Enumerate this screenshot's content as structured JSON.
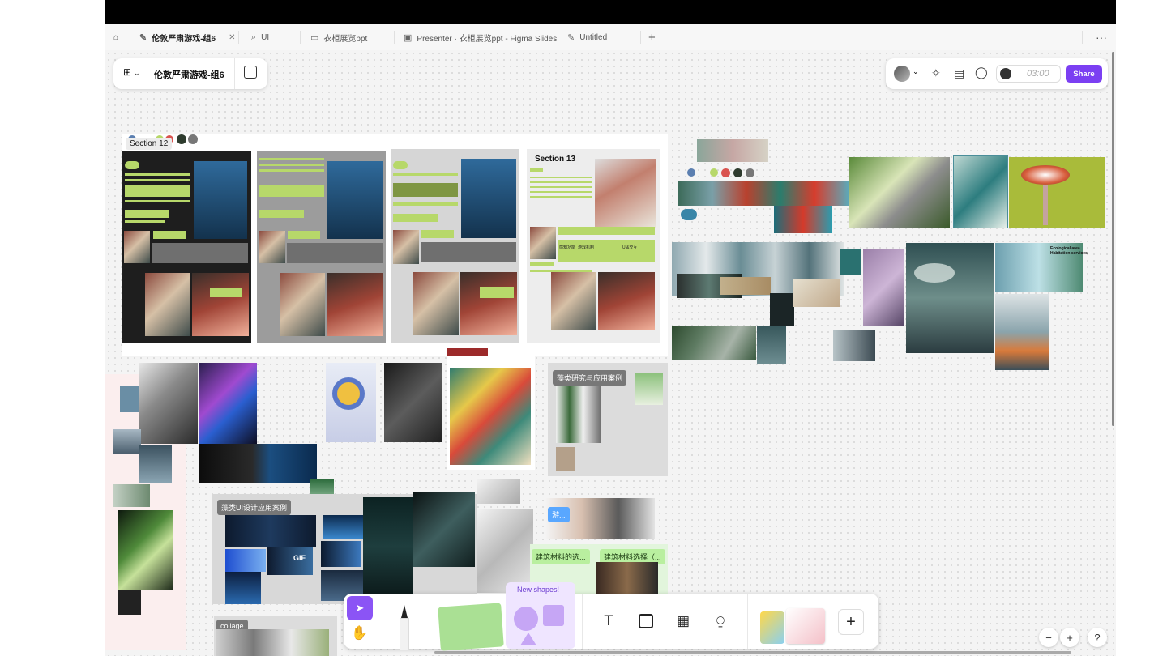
{
  "tabs": [
    {
      "label": "伦敦严肃游戏-组6",
      "icon": "pen-icon",
      "active": true
    },
    {
      "label": "UI",
      "icon": "tag-icon"
    },
    {
      "label": "衣柜展览ppt",
      "icon": "slides-icon"
    },
    {
      "label": "Presenter · 衣柜展览ppt - Figma Slides",
      "icon": "presenter-icon"
    },
    {
      "label": "Untitled",
      "icon": "pen-icon"
    }
  ],
  "file": {
    "title": "伦敦严肃游戏-组6"
  },
  "header": {
    "timer": "03:00",
    "share": "Share"
  },
  "canvas": {
    "section12": "Section 12",
    "section13": "Section 13",
    "algae_research": "藻类研究与应用案例",
    "algae_ui": "藻类UI设计应用案例",
    "you_tag": "游...",
    "material_tag1": "建筑材料的选...",
    "material_tag2": "建筑材料选择（...",
    "collage": "collage",
    "gif": "GIF",
    "eco_label": "Ecological area\nHabitation services",
    "s13_btn1": "感知功能",
    "s13_btn2": "游戏机制",
    "s13_btn3": "UI&交互"
  },
  "toolbar": {
    "new_shapes": "New shapes!"
  },
  "zoom": {
    "minus": "−",
    "plus": "+",
    "help": "?"
  },
  "colors": {
    "accent": "#7b3ff2",
    "green_bar": "#b7d86a"
  }
}
